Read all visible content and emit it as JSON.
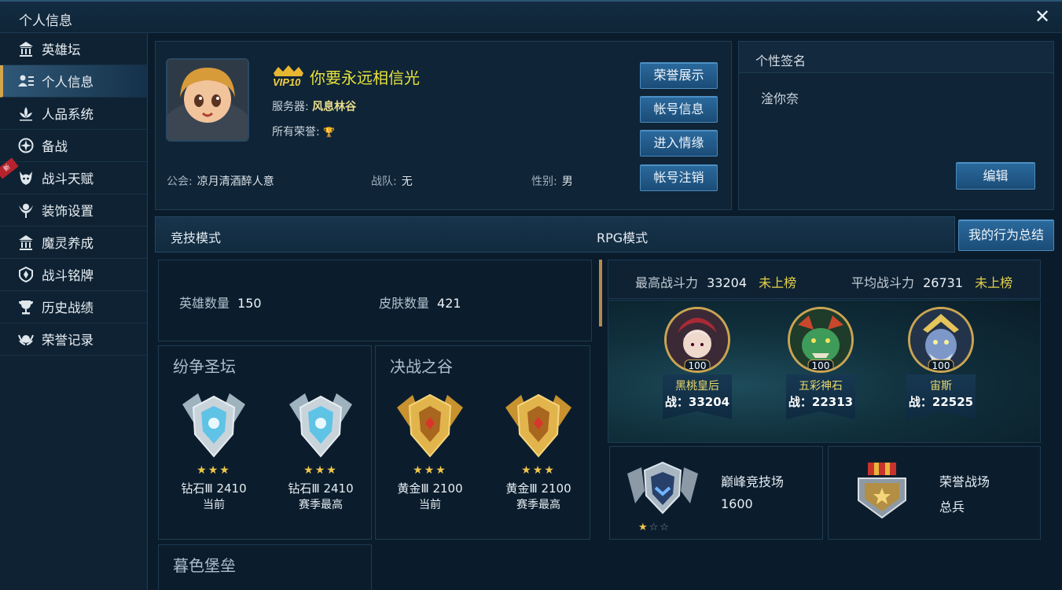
{
  "window": {
    "title": "个人信息",
    "close_label": "✕"
  },
  "sidebar": {
    "items": [
      {
        "label": "英雄坛",
        "icon": "temple-icon"
      },
      {
        "label": "个人信息",
        "icon": "profile-card-icon"
      },
      {
        "label": "人品系统",
        "icon": "lotus-icon"
      },
      {
        "label": "备战",
        "icon": "compass-icon"
      },
      {
        "label": "战斗天赋",
        "icon": "demon-head-icon",
        "badge": "新"
      },
      {
        "label": "装饰设置",
        "icon": "ornament-icon"
      },
      {
        "label": "魔灵养成",
        "icon": "temple-icon"
      },
      {
        "label": "战斗铭牌",
        "icon": "emblem-icon"
      },
      {
        "label": "历史战绩",
        "icon": "trophy-icon"
      },
      {
        "label": "荣誉记录",
        "icon": "honor-icon"
      }
    ]
  },
  "profile": {
    "vip": "VIP10",
    "name": "你要永远相信光",
    "server_label": "服务器:",
    "server": "风息林谷",
    "honor_label": "所有荣誉:",
    "guild_label": "公会:",
    "guild": "凉月清酒醉人意",
    "team_label": "战队:",
    "team": "无",
    "gender_label": "性别:",
    "gender": "男"
  },
  "actions": {
    "honor_show": "荣誉展示",
    "account_info": "帐号信息",
    "enter_romance": "进入情缘",
    "account_cancel": "帐号注销"
  },
  "signature": {
    "title": "个性签名",
    "text": "淦你奈",
    "edit": "编辑"
  },
  "modes": {
    "tab1": "竞技模式",
    "tab2": "RPG模式",
    "behavior_summary": "我的行为总结"
  },
  "stats": {
    "hero_count_label": "英雄数量",
    "hero_count": "150",
    "skin_count_label": "皮肤数量",
    "skin_count": "421"
  },
  "arenas": [
    {
      "title": "纷争圣坛",
      "ranks": [
        {
          "tier": "钻石Ⅲ 2410",
          "note": "当前",
          "type": "diamond"
        },
        {
          "tier": "钻石Ⅲ 2410",
          "note": "赛季最高",
          "type": "diamond"
        }
      ]
    },
    {
      "title": "决战之谷",
      "ranks": [
        {
          "tier": "黄金Ⅲ 2100",
          "note": "当前",
          "type": "gold"
        },
        {
          "tier": "黄金Ⅲ 2100",
          "note": "赛季最高",
          "type": "gold"
        }
      ]
    },
    {
      "title": "暮色堡垒"
    }
  ],
  "power": {
    "max_label": "最高战斗力",
    "max_value": "33204",
    "max_rank": "未上榜",
    "avg_label": "平均战斗力",
    "avg_value": "26731",
    "avg_rank": "未上榜"
  },
  "heroes": [
    {
      "name": "黑桃皇后",
      "level": "100",
      "power": "战：33204"
    },
    {
      "name": "五彩神石",
      "level": "100",
      "power": "战：22313"
    },
    {
      "name": "宙斯",
      "level": "100",
      "power": "战：22525"
    }
  ],
  "peak": {
    "title": "巅峰竞技场",
    "value": "1600",
    "stars_filled": 1,
    "stars_total": 3
  },
  "honor_field": {
    "title": "荣誉战场",
    "rank": "总兵"
  },
  "colors": {
    "accent_gold": "#d3a64b",
    "name_yellow": "#e6e23c",
    "button_blue": "#2b6a9e"
  }
}
